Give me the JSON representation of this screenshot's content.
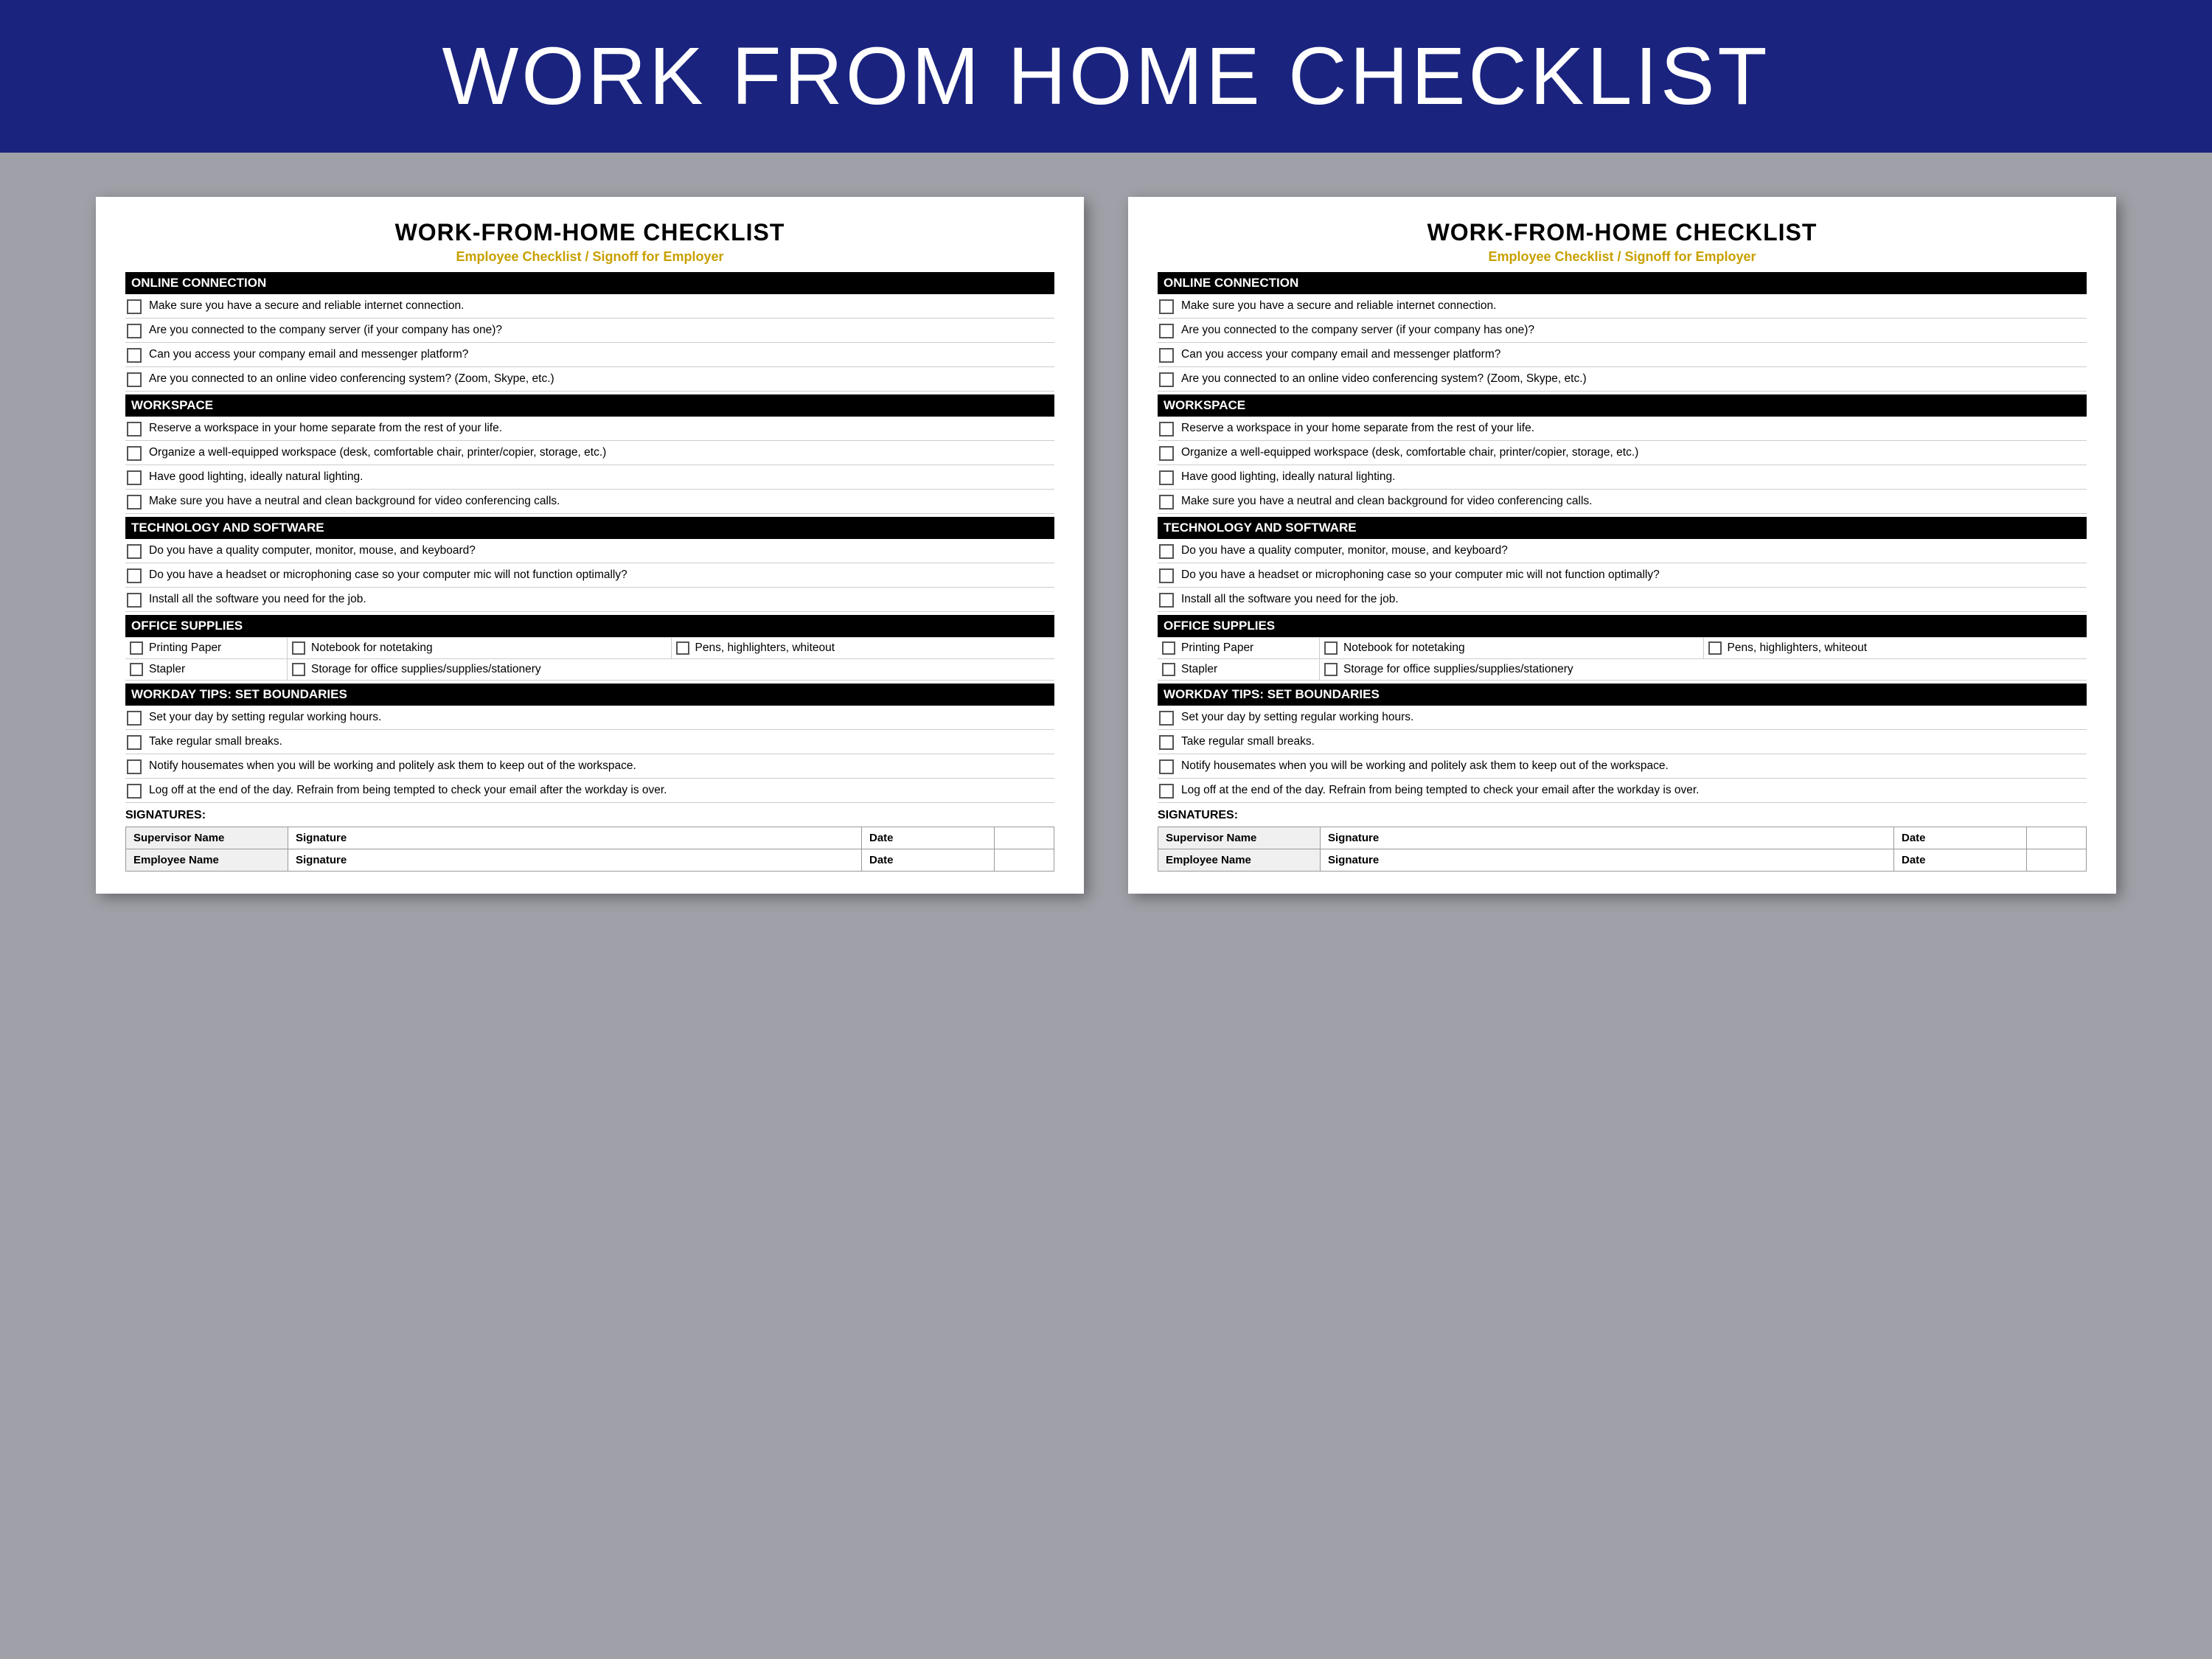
{
  "page": {
    "title": "WORK FROM HOME CHECKLIST",
    "background_color": "#a0a0a8",
    "header_bg": "#1a237e",
    "header_text_color": "#ffffff"
  },
  "checklist": {
    "card_title": "WORK-FROM-HOME CHECKLIST",
    "card_subtitle": "Employee Checklist / Signoff for Employer",
    "sections": [
      {
        "id": "online-connection",
        "header": "ONLINE CONNECTION",
        "items": [
          "Make sure you have a secure and reliable internet connection.",
          "Are you connected to the company server (if your company has one)?",
          "Can you access your company email and messenger platform?",
          "Are you connected to an online video conferencing system? (Zoom, Skype, etc.)"
        ]
      },
      {
        "id": "workspace",
        "header": "WORKSPACE",
        "items": [
          "Reserve a workspace in your home separate from the rest of your life.",
          "Organize a well-equipped workspace (desk, comfortable chair, printer/copier, storage, etc.)",
          "Have good lighting, ideally natural lighting.",
          "Make sure you have a neutral and clean background for video conferencing calls."
        ]
      },
      {
        "id": "technology",
        "header": "TECHNOLOGY AND SOFTWARE",
        "items": [
          "Do you have a quality computer, monitor, mouse, and keyboard?",
          "Do you have a headset or microphoning case so your computer mic will not function optimally?",
          "Install all the software you need for the job."
        ]
      }
    ],
    "office_supplies": {
      "header": "OFFICE SUPPLIES",
      "row1": {
        "col1": "Printing Paper",
        "col2_label": "Notebook for notetaking",
        "col3_label": "Pens, highlighters, whiteout"
      },
      "row2": {
        "col1": "Stapler",
        "col2_label": "Storage for office supplies/supplies/stationery"
      }
    },
    "workday_tips": {
      "header": "WORKDAY TIPS: SET BOUNDARIES",
      "items": [
        "Set your day by setting regular working hours.",
        "Take regular small breaks.",
        "Notify housemates when you will be working and politely ask them to keep out of the workspace.",
        "Log off at the end of the day. Refrain from being tempted to check your email after the workday is over."
      ]
    },
    "signatures": {
      "label": "SIGNATURES:",
      "rows": [
        {
          "name_label": "Supervisor Name",
          "sig_label": "Signature",
          "date_label": "Date"
        },
        {
          "name_label": "Employee Name",
          "sig_label": "Signature",
          "date_label": "Date"
        }
      ]
    }
  }
}
